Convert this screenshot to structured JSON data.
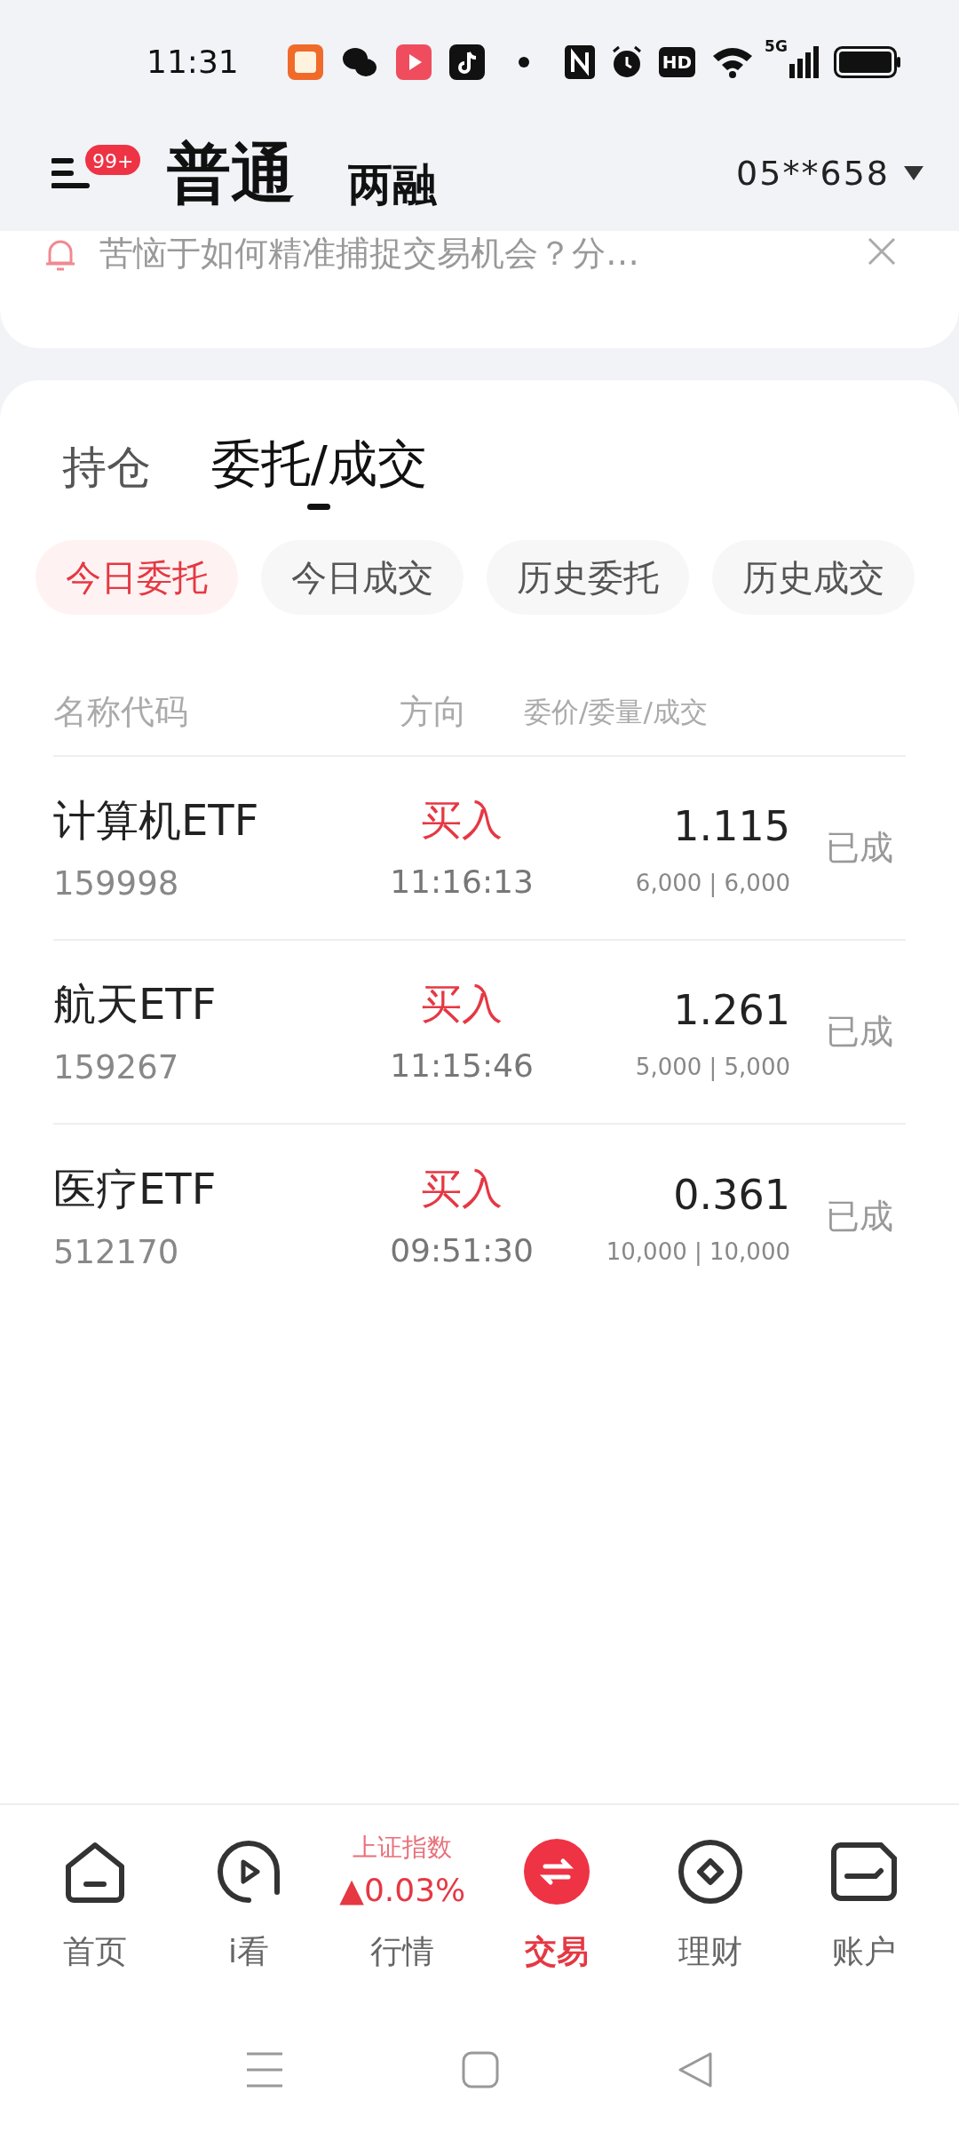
{
  "status_bar": {
    "time": "11:31",
    "hd_badge": "HD",
    "network": "5G"
  },
  "header": {
    "badge": "99+",
    "tabs": [
      {
        "label": "普通",
        "selected": true
      },
      {
        "label": "两融",
        "selected": false
      }
    ],
    "account": "05**658"
  },
  "banner": {
    "text": "苦恼于如何精准捕捉交易机会？分…"
  },
  "tabs": [
    {
      "label": "持仓",
      "selected": false
    },
    {
      "label": "委托/成交",
      "selected": true
    }
  ],
  "filters": [
    {
      "label": "今日委托",
      "selected": true
    },
    {
      "label": "今日成交",
      "selected": false
    },
    {
      "label": "历史委托",
      "selected": false
    },
    {
      "label": "历史成交",
      "selected": false
    }
  ],
  "table": {
    "columns": [
      "名称代码",
      "方向",
      "委价/委量/成交"
    ],
    "rows": [
      {
        "name": "计算机ETF",
        "code": "159998",
        "side": "买入",
        "kind": "buy",
        "time": "11:16:13",
        "price": "1.115",
        "quantity": "6,000 | 6,000",
        "status": "已成"
      },
      {
        "name": "航天ETF",
        "code": "159267",
        "side": "买入",
        "kind": "buy",
        "time": "11:15:46",
        "price": "1.261",
        "quantity": "5,000 | 5,000",
        "status": "已成"
      },
      {
        "name": "医疗ETF",
        "code": "512170",
        "side": "买入",
        "kind": "buy",
        "time": "09:51:30",
        "price": "0.361",
        "quantity": "10,000 | 10,000",
        "status": "已成"
      }
    ]
  },
  "bottom_nav": [
    {
      "kind": "home",
      "label": "首页",
      "selected": false
    },
    {
      "kind": "play",
      "label": "i看",
      "selected": false
    },
    {
      "kind": "index",
      "label": "行情",
      "index_name": "上证指数",
      "index_change": "▲0.03%",
      "selected": false
    },
    {
      "kind": "trade",
      "label": "交易",
      "selected": true
    },
    {
      "kind": "wealth",
      "label": "理财",
      "selected": false
    },
    {
      "kind": "account",
      "label": "账户",
      "selected": false
    }
  ]
}
